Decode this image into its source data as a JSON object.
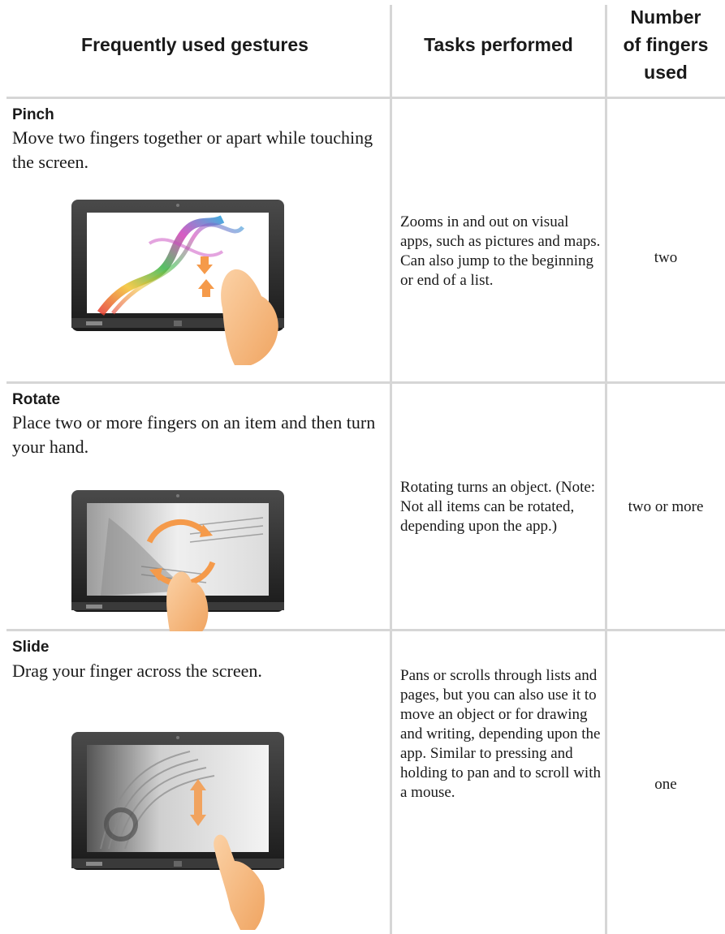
{
  "table": {
    "headers": {
      "gesture": "Frequently used gestures",
      "task": "Tasks performed",
      "fingers_line1": "Number",
      "fingers_line2": "of fingers",
      "fingers_line3": "used"
    },
    "rows": [
      {
        "name": "Pinch",
        "description": "Move two fingers together or apart while touching the screen.",
        "task": "Zooms in and out on visual apps, such as pictures and maps. Can also jump to the beginning or end of a list.",
        "fingers": "two",
        "illustration": "tablet-pinch-gesture"
      },
      {
        "name": "Rotate",
        "description": "Place two or more fingers on an item and then turn your hand.",
        "task": "Rotating turns an object. (Note: Not all items can be rotated, depending upon the app.)",
        "fingers": "two or more",
        "illustration": "tablet-rotate-gesture"
      },
      {
        "name": "Slide",
        "description": "Drag your finger across the screen.",
        "task": "Pans or scrolls through lists and pages, but you can also use it to move an object or for drawing and writing, depending upon the app. Similar to pressing and holding to pan and to scroll with a mouse.",
        "fingers": "one",
        "illustration": "tablet-slide-gesture"
      }
    ]
  },
  "colors": {
    "grid": "#d6d6d6",
    "text": "#1a1a1a",
    "hand": "#f4b27a",
    "arrow": "#f59a4a",
    "bezel": "#2a2a2a"
  }
}
